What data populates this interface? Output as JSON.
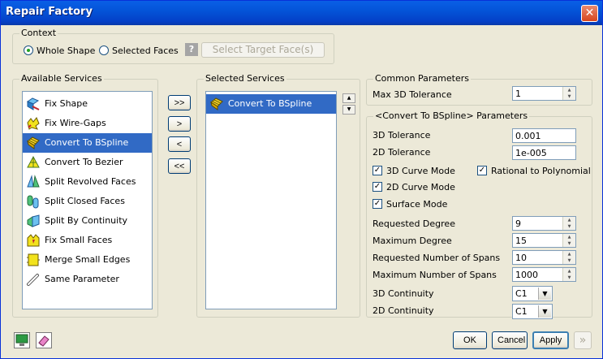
{
  "window": {
    "title": "Repair Factory"
  },
  "context": {
    "legend": "Context",
    "whole_shape": "Whole Shape",
    "selected_faces": "Selected Faces",
    "selected_mode": "Whole Shape",
    "select_target_button": "Select Target Face(s)",
    "help_glyph": "?"
  },
  "available": {
    "legend": "Available Services",
    "items": [
      {
        "label": "Fix Shape",
        "icon": "fix-shape-icon",
        "selected": false
      },
      {
        "label": "Fix Wire-Gaps",
        "icon": "fix-wire-gaps-icon",
        "selected": false
      },
      {
        "label": "Convert To BSpline",
        "icon": "convert-bspline-icon",
        "selected": true
      },
      {
        "label": "Convert To Bezier",
        "icon": "convert-bezier-icon",
        "selected": false
      },
      {
        "label": "Split Revolved Faces",
        "icon": "split-revolved-icon",
        "selected": false
      },
      {
        "label": "Split Closed Faces",
        "icon": "split-closed-icon",
        "selected": false
      },
      {
        "label": "Split By Continuity",
        "icon": "split-continuity-icon",
        "selected": false
      },
      {
        "label": "Fix Small Faces",
        "icon": "fix-small-faces-icon",
        "selected": false
      },
      {
        "label": "Merge Small Edges",
        "icon": "merge-small-edges-icon",
        "selected": false
      },
      {
        "label": "Same Parameter",
        "icon": "same-parameter-icon",
        "selected": false
      }
    ]
  },
  "transfer": {
    "add_all": ">>",
    "add": ">",
    "remove": "<",
    "remove_all": "<<"
  },
  "selected": {
    "legend": "Selected Services",
    "items": [
      {
        "label": "Convert To BSpline",
        "icon": "convert-bspline-icon",
        "selected": true
      }
    ],
    "up_glyph": "▲",
    "down_glyph": "▼"
  },
  "common": {
    "legend": "Common Parameters",
    "max_tol_label": "Max 3D Tolerance",
    "max_tol_value": "1"
  },
  "params": {
    "legend": "<Convert To BSpline> Parameters",
    "tol3d_label": "3D Tolerance",
    "tol3d_value": "0.001",
    "tol2d_label": "2D Tolerance",
    "tol2d_value": "1e-005",
    "curve3d_label": "3D Curve Mode",
    "curve2d_label": "2D Curve Mode",
    "surface_label": "Surface Mode",
    "rational_label": "Rational to Polynomial",
    "check_glyph": "✓",
    "req_degree_label": "Requested Degree",
    "req_degree_value": "9",
    "max_degree_label": "Maximum Degree",
    "max_degree_value": "15",
    "req_spans_label": "Requested Number of Spans",
    "req_spans_value": "10",
    "max_spans_label": "Maximum Number of Spans",
    "max_spans_value": "1000",
    "cont3d_label": "3D Continuity",
    "cont3d_value": "C1",
    "cont2d_label": "2D Continuity",
    "cont2d_value": "C1"
  },
  "footer": {
    "ok": "OK",
    "cancel": "Cancel",
    "apply": "Apply",
    "next_glyph": "»"
  },
  "colors": {
    "title_bar": "#0454d8",
    "selection": "#316ac5",
    "dialog_bg": "#ece9d8"
  }
}
